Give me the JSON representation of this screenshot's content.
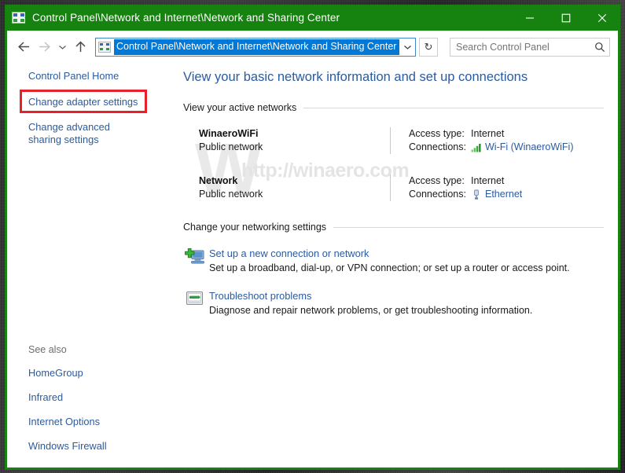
{
  "window": {
    "title": "Control Panel\\Network and Internet\\Network and Sharing Center",
    "icon": "control-panel-icon",
    "titlebar_color": "#16820f",
    "controls": {
      "minimize": "minimize-icon",
      "maximize": "maximize-icon",
      "close": "close-icon"
    }
  },
  "toolbar": {
    "back": "back-arrow-icon",
    "forward": "forward-arrow-icon",
    "recent": "recent-pages-chevron-icon",
    "up": "up-arrow-icon",
    "address_value": "Control Panel\\Network and Internet\\Network and Sharing Center",
    "address_caret": "chevron-down-icon",
    "refresh": "refresh-icon",
    "refresh_glyph": "↻",
    "search_placeholder": "Search Control Panel",
    "search_icon": "search-icon"
  },
  "sidebar": {
    "items": [
      {
        "label": "Control Panel Home",
        "highlighted": false
      },
      {
        "label": "Change adapter settings",
        "highlighted": true
      },
      {
        "label": "Change advanced sharing settings",
        "highlighted": false
      }
    ],
    "highlight_color": "#e8202a",
    "see_also_title": "See also",
    "see_also": [
      {
        "label": "HomeGroup"
      },
      {
        "label": "Infrared"
      },
      {
        "label": "Internet Options"
      },
      {
        "label": "Windows Firewall"
      }
    ]
  },
  "main": {
    "page_title": "View your basic network information and set up connections",
    "active_networks_heading": "View your active networks",
    "networks": [
      {
        "name": "WinaeroWiFi",
        "type": "Public network",
        "access_type_label": "Access type:",
        "access_type_value": "Internet",
        "connections_label": "Connections:",
        "connection_name": "Wi-Fi (WinaeroWiFi)",
        "connection_icon": "wifi-signal-icon"
      },
      {
        "name": "Network",
        "type": "Public network",
        "access_type_label": "Access type:",
        "access_type_value": "Internet",
        "connections_label": "Connections:",
        "connection_name": "Ethernet",
        "connection_icon": "ethernet-plug-icon"
      }
    ],
    "settings_heading": "Change your networking settings",
    "tasks": [
      {
        "title": "Set up a new connection or network",
        "description": "Set up a broadband, dial-up, or VPN connection; or set up a router or access point.",
        "icon": "new-connection-icon"
      },
      {
        "title": "Troubleshoot problems",
        "description": "Diagnose and repair network problems, or get troubleshooting information.",
        "icon": "troubleshoot-icon"
      }
    ]
  },
  "watermark": {
    "initial": "W",
    "url": "http://winaero.com"
  }
}
